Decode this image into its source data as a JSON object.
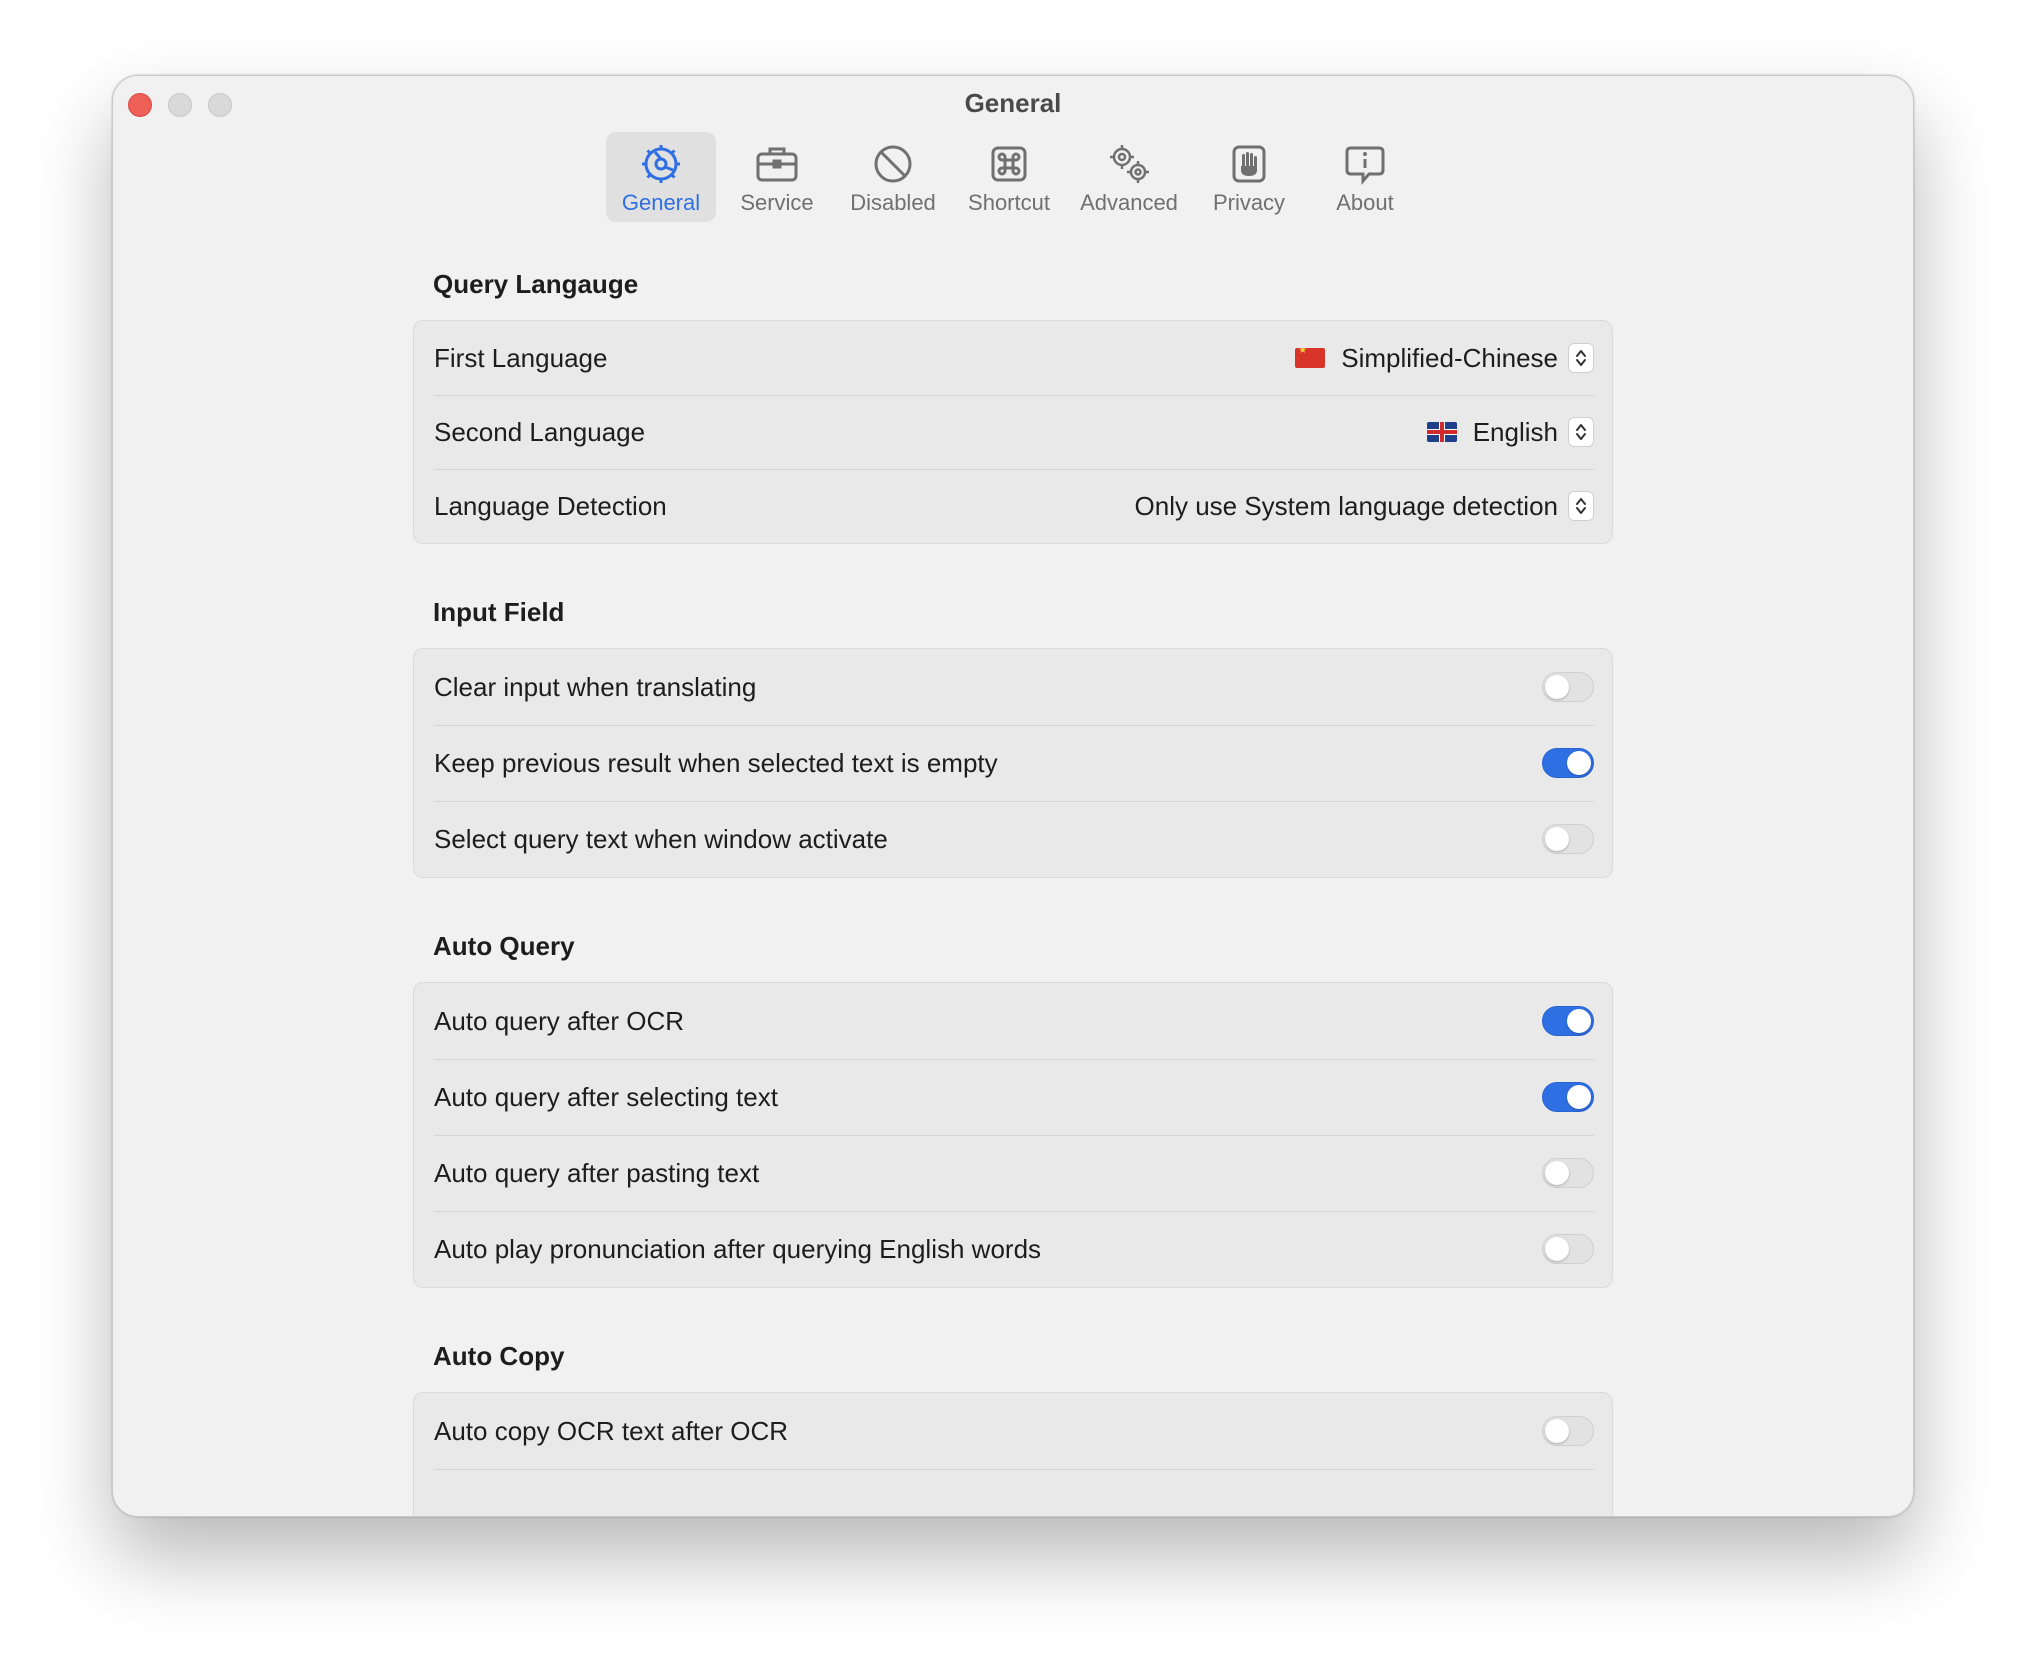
{
  "window": {
    "title": "General"
  },
  "toolbar": {
    "tabs": [
      {
        "label": "General",
        "icon": "gear-icon",
        "active": true
      },
      {
        "label": "Service",
        "icon": "briefcase-icon",
        "active": false
      },
      {
        "label": "Disabled",
        "icon": "prohibited-icon",
        "active": false
      },
      {
        "label": "Shortcut",
        "icon": "command-key-icon",
        "active": false
      },
      {
        "label": "Advanced",
        "icon": "gears-icon",
        "active": false
      },
      {
        "label": "Privacy",
        "icon": "hand-icon",
        "active": false
      },
      {
        "label": "About",
        "icon": "info-bubble-icon",
        "active": false
      }
    ]
  },
  "colors": {
    "accent": "#2f6fe4",
    "window_bg": "#f1f1f1",
    "group_bg": "#e9e9e9",
    "close": "#ee5f58"
  },
  "sections": {
    "query_language": {
      "title": "Query Langauge",
      "first_language": {
        "label": "First Language",
        "value": "Simplified-Chinese",
        "flag": "china-flag"
      },
      "second_language": {
        "label": "Second Language",
        "value": "English",
        "flag": "uk-flag"
      },
      "language_detection": {
        "label": "Language Detection",
        "value": "Only use System language detection"
      }
    },
    "input_field": {
      "title": "Input Field",
      "rows": [
        {
          "label": "Clear input when translating",
          "on": false
        },
        {
          "label": "Keep previous result when selected text is empty",
          "on": true
        },
        {
          "label": "Select query text when window activate",
          "on": false
        }
      ]
    },
    "auto_query": {
      "title": "Auto Query",
      "rows": [
        {
          "label": "Auto query after OCR",
          "on": true
        },
        {
          "label": "Auto query after selecting text",
          "on": true
        },
        {
          "label": "Auto query after pasting text",
          "on": false
        },
        {
          "label": "Auto play pronunciation after querying English words",
          "on": false
        }
      ]
    },
    "auto_copy": {
      "title": "Auto Copy",
      "rows": [
        {
          "label": "Auto copy OCR text after OCR",
          "on": false
        }
      ]
    }
  }
}
